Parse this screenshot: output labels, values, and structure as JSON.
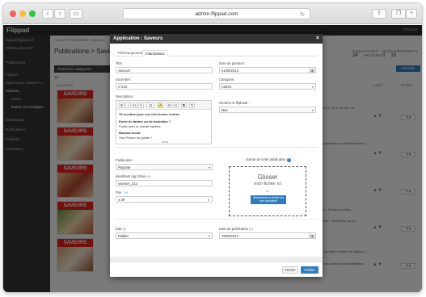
{
  "browser": {
    "url": "admin-flippad.com",
    "back_icon": "‹",
    "forward_icon": "›"
  },
  "app": {
    "logo": "Flippad",
    "user": "Français",
    "sidebar": {
      "items": [
        {
          "label": "flippad@gjsaint.fr"
        },
        {
          "label": "Tableau De Bord"
        },
        {
          "label": "Publications"
        },
        {
          "label": "Flippad"
        },
        {
          "label": "Saint Gruss Media Pu…"
        },
        {
          "label": "Saveurs"
        },
        {
          "label": "Autres"
        },
        {
          "label": "Toutes Les Catégori…"
        },
        {
          "label": "Statistiques"
        },
        {
          "label": "Notifications"
        },
        {
          "label": "Publicité"
        },
        {
          "label": "Assistance"
        }
      ]
    },
    "breadcrumb": "Accueil / Publications / Saveurs",
    "page_title": "Publications > Saveurs",
    "stats": {
      "publications_label": "PUBLICATIONS",
      "publications_value": "24",
      "archives_label": "ARCHIVES",
      "archives_value": "0",
      "telechargements_label": "TÉLÉCHARGEMENTS",
      "telechargements_value": "10"
    },
    "category_tab": "Toutes les catégories",
    "new_pub_button": "Nouvelle publication",
    "count": "16",
    "columns": {
      "cover": "Couverture",
      "action": "Action",
      "gestion": "Gestion"
    },
    "row_texts": [
      "sur le TV ou la VIN, nu…",
      "scandinave au Guatemala les…",
      "",
      "pic, Suwan ou Wrap…",
      "table : Guernsey, sur le…",
      "s de frites recettes de gâteaux…",
      "vous ajoutez à la preparation…"
    ]
  },
  "modal": {
    "title": "Application : Saveurs",
    "close_icon": "×",
    "tabs": [
      "Téléchargement",
      "Informations"
    ],
    "fields": {
      "titre_label": "Titre :",
      "titre_value": "Saveurs",
      "date_parution_label": "Date de parution :",
      "date_parution_value": "01/09/2014",
      "sous_titre_label": "Sous-titre :",
      "sous_titre_value": "n°213",
      "categorie_label": "Catégorie :",
      "categorie_value": "Autres",
      "description_label": "Description :",
      "generer_label": "Générer le flipbook :",
      "generer_value": "Non",
      "publication_label": "Publication :",
      "publication_value": "Payante",
      "identifiant_label": "Identifiant App Store",
      "identifiant_value": "saveurs_213",
      "prix_label": "Prix :",
      "prix_value": "4.49",
      "etat_label": "Etat",
      "etat_value": "Publier",
      "date_publication_label": "Date de publication",
      "date_publication_value": "29/08/2014"
    },
    "editor": {
      "toolbar": [
        "B",
        "I",
        "U",
        "✎",
        "11",
        "A",
        "☰",
        "☷",
        "⧉",
        "¶"
      ],
      "lines": [
        "75 recettes pour une très bonne rentrée",
        "",
        "Envie de tartare ou de boulettes ?",
        "Facile avec la viande hachée",
        "",
        "Banana bread",
        "Vive l'heure du goûter !"
      ]
    },
    "extract_label": "Extrait de votre publication",
    "dropzone": {
      "line1": "Glisser",
      "line2": "mon fichier ici",
      "or": "ou",
      "button": "Sélectionner un fichier sur mon ordinateur"
    },
    "footer": {
      "close": "Fermer",
      "publish": "Publier"
    }
  }
}
